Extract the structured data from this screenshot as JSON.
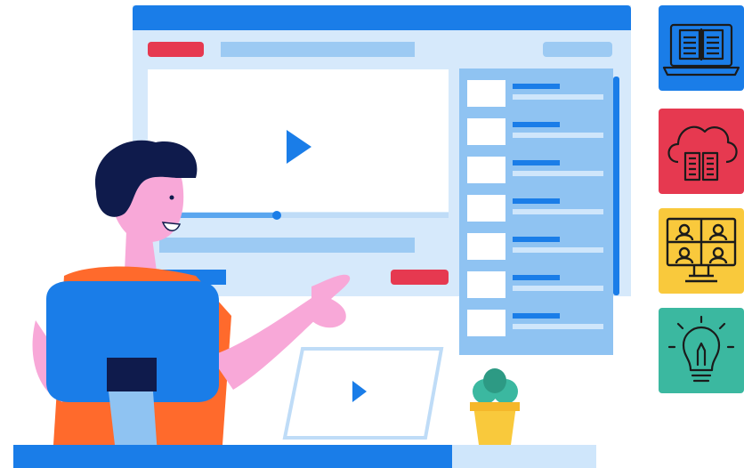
{
  "app": {
    "name": ""
  },
  "player": {
    "progress": 0.43
  },
  "playlist": {
    "item_count": 7
  },
  "cards": [
    {
      "icon": "laptop-book-icon",
      "color": "#1a7de8"
    },
    {
      "icon": "cloud-book-icon",
      "color": "#e63950"
    },
    {
      "icon": "video-conference-icon",
      "color": "#f9c93c"
    },
    {
      "icon": "idea-bulb-icon",
      "color": "#3bb8a0"
    }
  ],
  "colors": {
    "primary": "#1a7de8",
    "accent_red": "#e63950",
    "light_blue": "#d6e9fb",
    "mid_blue": "#8fc3f2"
  }
}
